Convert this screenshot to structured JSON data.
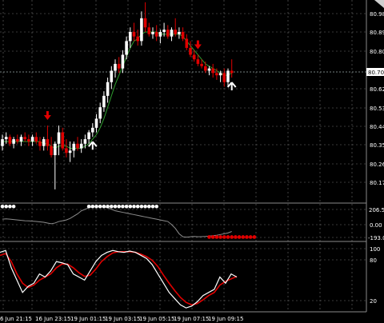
{
  "price_axis": {
    "labels": [
      "80.980",
      "80.890",
      "80.800",
      "80.620",
      "80.530",
      "80.440",
      "80.350",
      "80.260",
      "80.170"
    ],
    "current_price": "80.700"
  },
  "osc1_axis": {
    "labels": [
      "206.54",
      "0.00",
      "-193.04"
    ]
  },
  "osc2_axis": {
    "labels": [
      "100",
      "80",
      "20"
    ]
  },
  "time_axis": {
    "labels": [
      "6 Jun 21:15",
      "16 Jun 23:15",
      "19 Jun 01:15",
      "19 Jun 03:15",
      "19 Jun 05:15",
      "19 Jun 07:15",
      "19 Jun 09:15"
    ]
  },
  "colors": {
    "background": "#000000",
    "bull": "#ffffff",
    "bear": "#e00000",
    "ma_line": "#2e9e2e",
    "signal_down": "#e00000",
    "signal_up": "#ffffff",
    "stoch_main": "#ffffff",
    "stoch_signal": "#e00000",
    "cci_line": "#8c8c8c"
  },
  "chart_data": {
    "type": "candlestick",
    "price_range": [
      80.13,
      81.02
    ],
    "candles": [
      [
        80.38,
        80.43,
        80.36,
        80.41
      ],
      [
        80.41,
        80.44,
        80.39,
        80.42
      ],
      [
        80.42,
        80.43,
        80.38,
        80.39
      ],
      [
        80.39,
        80.42,
        80.37,
        80.41
      ],
      [
        80.41,
        80.43,
        80.39,
        80.4
      ],
      [
        80.4,
        80.43,
        80.38,
        80.42
      ],
      [
        80.42,
        80.44,
        80.4,
        80.41
      ],
      [
        80.41,
        80.43,
        80.38,
        80.4
      ],
      [
        80.4,
        80.43,
        80.38,
        80.42
      ],
      [
        80.42,
        80.44,
        80.39,
        80.4
      ],
      [
        80.4,
        80.42,
        80.36,
        80.38
      ],
      [
        80.38,
        80.42,
        80.36,
        80.41
      ],
      [
        80.41,
        80.47,
        80.36,
        80.38
      ],
      [
        80.38,
        80.42,
        80.33,
        80.34
      ],
      [
        80.34,
        80.4,
        80.19,
        80.39
      ],
      [
        80.39,
        80.47,
        80.34,
        80.44
      ],
      [
        80.44,
        80.46,
        80.36,
        80.37
      ],
      [
        80.37,
        80.41,
        80.33,
        80.35
      ],
      [
        80.35,
        80.4,
        80.31,
        80.36
      ],
      [
        80.36,
        80.4,
        80.33,
        80.39
      ],
      [
        80.39,
        80.42,
        80.36,
        80.37
      ],
      [
        80.37,
        80.41,
        80.35,
        80.39
      ],
      [
        80.39,
        80.43,
        80.37,
        80.41
      ],
      [
        80.41,
        80.45,
        80.39,
        80.44
      ],
      [
        80.44,
        80.48,
        80.42,
        80.46
      ],
      [
        80.46,
        80.52,
        80.44,
        80.5
      ],
      [
        80.5,
        80.57,
        80.48,
        80.55
      ],
      [
        80.55,
        80.62,
        80.53,
        80.6
      ],
      [
        80.6,
        80.68,
        80.57,
        80.66
      ],
      [
        80.66,
        80.73,
        80.63,
        80.71
      ],
      [
        80.71,
        80.76,
        80.68,
        80.74
      ],
      [
        80.74,
        80.77,
        80.7,
        80.72
      ],
      [
        80.72,
        80.8,
        80.7,
        80.78
      ],
      [
        80.78,
        80.86,
        80.76,
        80.84
      ],
      [
        80.84,
        80.9,
        80.81,
        80.88
      ],
      [
        80.88,
        80.92,
        80.84,
        80.86
      ],
      [
        80.86,
        80.89,
        80.82,
        80.84
      ],
      [
        80.84,
        80.97,
        80.82,
        80.94
      ],
      [
        80.94,
        81.01,
        80.88,
        80.9
      ],
      [
        80.9,
        80.92,
        80.86,
        80.87
      ],
      [
        80.87,
        80.9,
        80.85,
        80.88
      ],
      [
        80.88,
        80.91,
        80.84,
        80.86
      ],
      [
        80.86,
        80.89,
        80.83,
        80.88
      ],
      [
        80.88,
        80.92,
        80.86,
        80.89
      ],
      [
        80.89,
        80.91,
        80.85,
        80.86
      ],
      [
        80.86,
        80.9,
        80.84,
        80.89
      ],
      [
        80.89,
        80.94,
        80.86,
        80.87
      ],
      [
        80.87,
        80.9,
        80.85,
        80.88
      ],
      [
        80.88,
        80.9,
        80.84,
        80.85
      ],
      [
        80.85,
        80.87,
        80.8,
        80.81
      ],
      [
        80.81,
        80.84,
        80.77,
        80.78
      ],
      [
        80.78,
        80.8,
        80.75,
        80.76
      ],
      [
        80.76,
        80.78,
        80.73,
        80.74
      ],
      [
        80.74,
        80.76,
        80.72,
        80.73
      ],
      [
        80.73,
        80.75,
        80.7,
        80.71
      ],
      [
        80.71,
        80.73,
        80.69,
        80.72
      ],
      [
        80.72,
        80.74,
        80.68,
        80.7
      ],
      [
        80.7,
        80.72,
        80.67,
        80.69
      ],
      [
        80.69,
        80.71,
        80.66,
        80.7
      ],
      [
        80.7,
        80.72,
        80.64,
        80.66
      ],
      [
        80.66,
        80.72,
        80.64,
        80.71
      ],
      [
        80.71,
        80.76,
        80.68,
        80.7
      ]
    ],
    "ma": [
      80.4,
      80.4,
      80.4,
      80.4,
      80.4,
      80.4,
      80.4,
      80.4,
      80.4,
      80.4,
      80.4,
      80.39,
      80.39,
      80.38,
      80.37,
      80.38,
      80.38,
      80.38,
      80.37,
      80.37,
      80.37,
      80.37,
      80.38,
      80.39,
      80.41,
      80.43,
      80.46,
      80.5,
      80.55,
      80.6,
      80.65,
      80.69,
      80.73,
      80.77,
      80.81,
      80.84,
      80.85,
      80.87,
      80.88,
      80.88,
      80.88,
      80.88,
      80.87,
      80.87,
      80.87,
      80.87,
      80.87,
      80.87,
      80.86,
      80.84,
      80.82,
      80.8,
      80.78,
      80.76,
      80.74,
      80.73,
      80.72,
      80.71,
      80.7,
      80.69,
      80.69,
      80.7
    ],
    "signals": [
      {
        "index": 12,
        "direction": "down"
      },
      {
        "index": 24,
        "direction": "up"
      },
      {
        "index": 52,
        "direction": "down"
      },
      {
        "index": 61,
        "direction": "up"
      }
    ],
    "cci_range": [
      -230,
      230
    ],
    "cci": [
      40,
      45,
      40,
      35,
      30,
      25,
      20,
      18,
      15,
      10,
      5,
      0,
      -10,
      -20,
      -10,
      10,
      20,
      30,
      50,
      80,
      110,
      150,
      170,
      190,
      200,
      205,
      210,
      200,
      190,
      170,
      150,
      140,
      130,
      120,
      110,
      100,
      90,
      80,
      70,
      60,
      50,
      40,
      30,
      20,
      10,
      -30,
      -80,
      -150,
      -190,
      -195,
      -190,
      -185,
      -190,
      -188,
      -185,
      -180,
      -175,
      -170,
      -160,
      -150,
      -140,
      -120
    ],
    "cci_dots": {
      "white": {
        "from": 0,
        "to": 3,
        "y": 206.54
      },
      "white2": {
        "from": 23,
        "to": 41,
        "y": 206.54
      },
      "red": {
        "from": 55,
        "to": 67,
        "y": -193.04
      }
    },
    "stoch_range": [
      0,
      110
    ],
    "stoch_main": [
      95,
      98,
      70,
      50,
      30,
      40,
      45,
      60,
      55,
      65,
      80,
      78,
      75,
      60,
      55,
      50,
      65,
      80,
      90,
      95,
      98,
      96,
      95,
      97,
      95,
      90,
      85,
      75,
      60,
      45,
      30,
      20,
      10,
      5,
      8,
      15,
      25,
      30,
      35,
      55,
      45,
      60,
      55
    ],
    "stoch_signal": [
      90,
      93,
      80,
      60,
      45,
      38,
      42,
      50,
      55,
      60,
      70,
      76,
      76,
      70,
      62,
      56,
      58,
      68,
      80,
      88,
      94,
      96,
      96,
      96,
      95,
      92,
      88,
      82,
      72,
      58,
      45,
      33,
      22,
      14,
      10,
      12,
      18,
      25,
      30,
      42,
      48,
      52,
      56
    ]
  }
}
